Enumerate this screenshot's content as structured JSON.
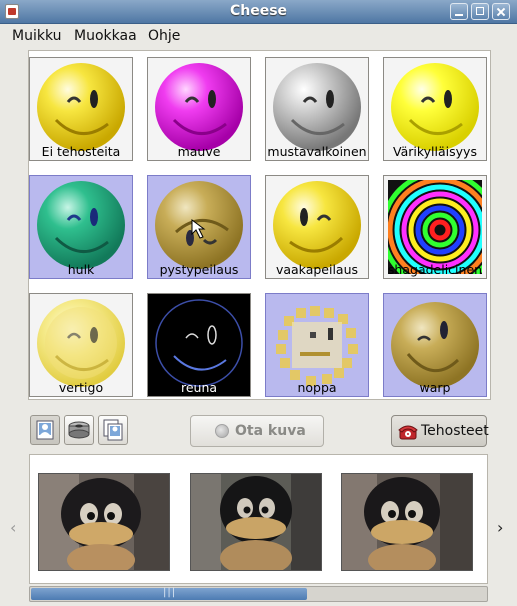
{
  "window": {
    "title": "Cheese"
  },
  "menu": [
    "Muikku",
    "Muokkaa",
    "Ohje"
  ],
  "effects": [
    {
      "label": "Ei tehosteita",
      "selected": false
    },
    {
      "label": "mauve",
      "selected": false
    },
    {
      "label": "mustavalkoinen",
      "selected": false
    },
    {
      "label": "Värikylläisyys",
      "selected": false
    },
    {
      "label": "hulk",
      "selected": true
    },
    {
      "label": "pystypeilaus",
      "selected": true
    },
    {
      "label": "vaakapeilaus",
      "selected": false
    },
    {
      "label": "shagadelicinen",
      "selected": false
    },
    {
      "label": "vertigo",
      "selected": false
    },
    {
      "label": "reuna",
      "selected": false
    },
    {
      "label": "noppa",
      "selected": true
    },
    {
      "label": "warp",
      "selected": true
    }
  ],
  "toolbar": {
    "take_photo_label": "Ota kuva",
    "effects_label": "Tehosteet"
  },
  "icons": {
    "mode_photo": "photo-mode-icon",
    "mode_video": "video-mode-icon",
    "mode_burst": "burst-mode-icon",
    "shoot": "camera-dot-icon",
    "effects": "telephone-icon",
    "gallery_prev": "chevron-left-icon",
    "gallery_next": "chevron-right-icon"
  },
  "gallery": {
    "prev": "‹",
    "next": "›",
    "photos": [
      {
        "name": "photo-1"
      },
      {
        "name": "photo-2"
      },
      {
        "name": "photo-3"
      }
    ],
    "scroll_grip": "|||"
  },
  "colors": {
    "selection": "#b9b9ee",
    "titlebar": "#4f77a4",
    "scroll_thumb": "#4d7bb2"
  }
}
